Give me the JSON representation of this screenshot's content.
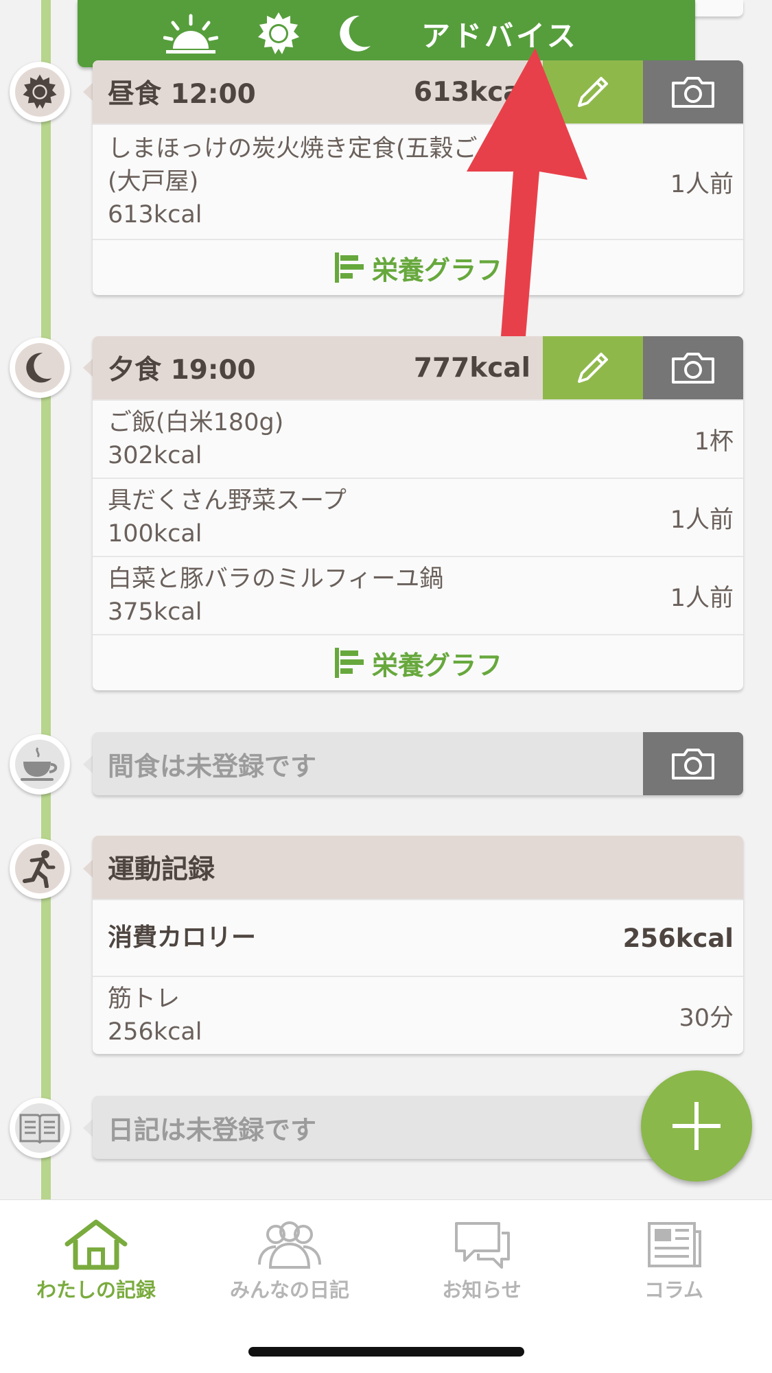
{
  "banner": {
    "label": "アドバイス"
  },
  "lunch": {
    "title": "昼食 12:00",
    "kcal": "613kcal",
    "items": [
      {
        "name": "しまほっけの炭火焼き定食(五穀ご",
        "name2": "(大戸屋)",
        "cal": "613kcal",
        "qty": "1人前"
      }
    ],
    "graph_label": "栄養グラフ"
  },
  "dinner": {
    "title": "夕食 19:00",
    "kcal": "777kcal",
    "items": [
      {
        "name": "ご飯(白米180g)",
        "cal": "302kcal",
        "qty": "1杯"
      },
      {
        "name": "具だくさん野菜スープ",
        "cal": "100kcal",
        "qty": "1人前"
      },
      {
        "name": "白菜と豚バラのミルフィーユ鍋",
        "cal": "375kcal",
        "qty": "1人前"
      }
    ],
    "graph_label": "栄養グラフ"
  },
  "snack": {
    "text": "間食は未登録です"
  },
  "exercise": {
    "title": "運動記録",
    "burned_label": "消費カロリー",
    "burned_value": "256kcal",
    "items": [
      {
        "name": "筋トレ",
        "cal": "256kcal",
        "qty": "30分"
      }
    ]
  },
  "diary": {
    "text": "日記は未登録です"
  },
  "tabs": [
    {
      "label": "わたしの記録",
      "icon": "home-icon",
      "active": true
    },
    {
      "label": "みんなの日記",
      "icon": "people-icon",
      "active": false
    },
    {
      "label": "お知らせ",
      "icon": "chat-icon",
      "active": false
    },
    {
      "label": "コラム",
      "icon": "newspaper-icon",
      "active": false
    }
  ],
  "colors": {
    "accent_green": "#569e3c",
    "timeline_green": "#b7d58c",
    "header_beige": "#e3d9d4",
    "edit_green": "#8fb84b",
    "camera_grey": "#767676",
    "arrow_red": "#e8404a"
  }
}
